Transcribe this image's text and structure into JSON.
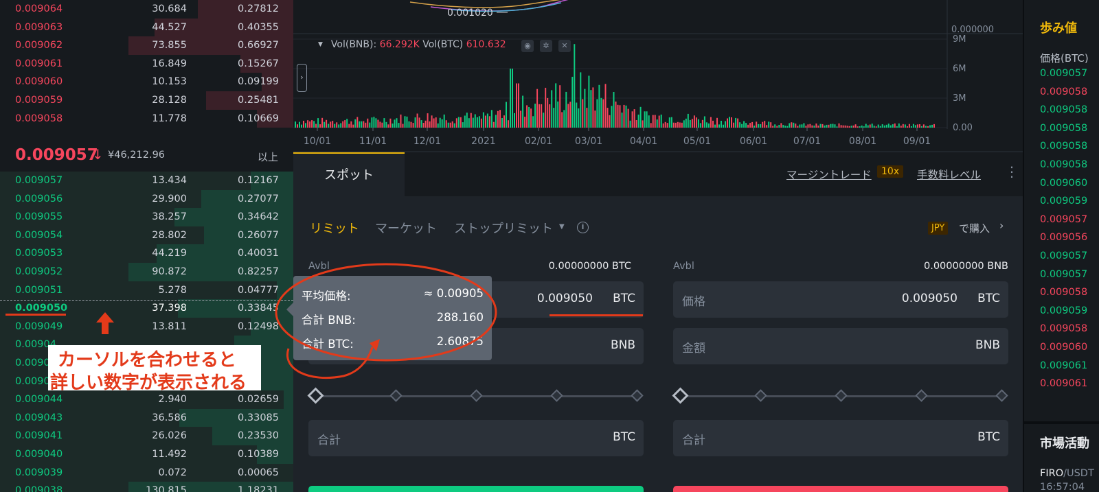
{
  "orderbook": {
    "asks": [
      {
        "price": "0.009064",
        "amount": "30.684",
        "total": "0.27812",
        "depth": 0.58
      },
      {
        "price": "0.009063",
        "amount": "44.527",
        "total": "0.40355",
        "depth": 0.84
      },
      {
        "price": "0.009062",
        "amount": "73.855",
        "total": "0.66927",
        "depth": 1.0
      },
      {
        "price": "0.009061",
        "amount": "16.849",
        "total": "0.15267",
        "depth": 0.32
      },
      {
        "price": "0.009060",
        "amount": "10.153",
        "total": "0.09199",
        "depth": 0.19
      },
      {
        "price": "0.009059",
        "amount": "28.128",
        "total": "0.25481",
        "depth": 0.53
      },
      {
        "price": "0.009058",
        "amount": "11.778",
        "total": "0.10669",
        "depth": 0.22
      }
    ],
    "mid": {
      "price": "0.009057",
      "arrow": "↓",
      "fiat": "¥46,212.96",
      "more": "以上"
    },
    "bids": [
      {
        "price": "0.009057",
        "amount": "13.434",
        "total": "0.12167",
        "depth": 0.26
      },
      {
        "price": "0.009056",
        "amount": "29.900",
        "total": "0.27077",
        "depth": 0.56
      },
      {
        "price": "0.009055",
        "amount": "38.257",
        "total": "0.34642",
        "depth": 0.72
      },
      {
        "price": "0.009054",
        "amount": "28.802",
        "total": "0.26077",
        "depth": 0.54
      },
      {
        "price": "0.009053",
        "amount": "44.219",
        "total": "0.40031",
        "depth": 0.83
      },
      {
        "price": "0.009052",
        "amount": "90.872",
        "total": "0.82257",
        "depth": 1.0
      },
      {
        "price": "0.009051",
        "amount": "5.278",
        "total": "0.04777",
        "depth": 0.1
      },
      {
        "price": "0.009050",
        "amount": "37.398",
        "total": "0.33845",
        "depth": 0.7
      },
      {
        "price": "0.009049",
        "amount": "13.811",
        "total": "0.12498",
        "depth": 0.26
      },
      {
        "price": "0.00904",
        "amount": "",
        "total": "",
        "depth": 0.36
      },
      {
        "price": "0.00904",
        "amount": "",
        "total": "",
        "depth": 0.4
      },
      {
        "price": "0.00904",
        "amount": "",
        "total": "",
        "depth": 0.3
      },
      {
        "price": "0.009044",
        "amount": "2.940",
        "total": "0.02659",
        "depth": 0.06
      },
      {
        "price": "0.009043",
        "amount": "36.586",
        "total": "0.33085",
        "depth": 0.69
      },
      {
        "price": "0.009041",
        "amount": "26.026",
        "total": "0.23530",
        "depth": 0.49
      },
      {
        "price": "0.009040",
        "amount": "11.492",
        "total": "0.10389",
        "depth": 0.22
      },
      {
        "price": "0.009039",
        "amount": "0.072",
        "total": "0.00065",
        "depth": 0.0
      },
      {
        "price": "0.009038",
        "amount": "130.815",
        "total": "1.18231",
        "depth": 1.0
      }
    ],
    "callout": {
      "line1": "カーソルを合わせると",
      "line2": "詳しい数字が表示される"
    }
  },
  "chart": {
    "price_label": "0.001020",
    "axis_zero_price": "0.000000",
    "vol_label_bnb": "Vol(BNB):",
    "vol_value_bnb": "66.292K",
    "vol_label_btc": "Vol(BTC)",
    "vol_value_btc": "610.632",
    "vol_axis": [
      "9M",
      "6M",
      "3M",
      "0.00"
    ],
    "x_ticks": [
      "10/01",
      "11/01",
      "12/01",
      "2021",
      "02/01",
      "03/01",
      "04/01",
      "05/01",
      "06/01",
      "07/01",
      "08/01",
      "09/01"
    ]
  },
  "chart_data": {
    "type": "bar",
    "title": "",
    "xlabel": "",
    "ylabel": "",
    "categories": [
      "10/01",
      "11/01",
      "12/01",
      "2021",
      "02/01",
      "03/01",
      "04/01",
      "05/01",
      "06/01",
      "07/01",
      "08/01",
      "09/01"
    ],
    "series": [
      {
        "name": "Vol(BNB)",
        "values": [
          0.7,
          0.8,
          1.2,
          1.1,
          3.0,
          4.2,
          1.3,
          1.0,
          0.6,
          0.3,
          0.3,
          0.3
        ]
      }
    ],
    "peaks": [
      {
        "x": "03/01",
        "value": 8.5
      },
      {
        "x": "02/01",
        "value": 6.0
      },
      {
        "x": "02/01",
        "value": 4.5
      }
    ],
    "ylim": [
      0,
      9
    ],
    "y_unit": "M",
    "colors": {
      "up": "#0ecb81",
      "down": "#f6465d"
    }
  },
  "spot": {
    "tab": "スポット",
    "margin_link": "マージントレード",
    "margin_badge": "10x",
    "fee_link": "手数料レベル",
    "kebab": "⋮",
    "order_tabs": {
      "limit": "リミット",
      "market": "マーケット",
      "stop": "ストップリミット"
    },
    "stop_caret": "▼",
    "info": "i",
    "jpy_badge": "JPY",
    "jpy_buy": "で購入",
    "chevron": "›",
    "buy": {
      "avbl_label": "Avbl",
      "avbl_value": "0.00000000 BTC",
      "price_value": "0.009050",
      "price_unit": "BTC",
      "amount_unit": "BNB",
      "total_label": "合計",
      "total_unit": "BTC",
      "slider_level": 0
    },
    "sell": {
      "avbl_label": "Avbl",
      "avbl_value": "0.00000000 BNB",
      "price_label": "価格",
      "price_value": "0.009050",
      "price_unit": "BTC",
      "amount_label": "金額",
      "amount_unit": "BNB",
      "total_label": "合計",
      "total_unit": "BTC",
      "slider_level": 0
    }
  },
  "tooltip": {
    "avg_label": "平均価格:",
    "avg_value": "≈ 0.00905",
    "bnb_label": "合計 BNB:",
    "bnb_value": "288.160",
    "btc_label": "合計 BTC:",
    "btc_value": "2.60875"
  },
  "trades": {
    "title": "歩み値",
    "col": "価格(BTC)",
    "rows": [
      {
        "price": "0.009057",
        "side": "buy"
      },
      {
        "price": "0.009058",
        "side": "sell"
      },
      {
        "price": "0.009058",
        "side": "buy"
      },
      {
        "price": "0.009058",
        "side": "buy"
      },
      {
        "price": "0.009058",
        "side": "buy"
      },
      {
        "price": "0.009058",
        "side": "buy"
      },
      {
        "price": "0.009060",
        "side": "buy"
      },
      {
        "price": "0.009059",
        "side": "buy"
      },
      {
        "price": "0.009057",
        "side": "sell"
      },
      {
        "price": "0.009056",
        "side": "sell"
      },
      {
        "price": "0.009057",
        "side": "buy"
      },
      {
        "price": "0.009057",
        "side": "buy"
      },
      {
        "price": "0.009058",
        "side": "sell"
      },
      {
        "price": "0.009059",
        "side": "buy"
      },
      {
        "price": "0.009058",
        "side": "sell"
      },
      {
        "price": "0.009060",
        "side": "sell"
      },
      {
        "price": "0.009061",
        "side": "buy"
      },
      {
        "price": "0.009061",
        "side": "sell"
      }
    ],
    "activity_title": "市場活動",
    "activity_pair_base": "FIRO",
    "activity_pair_quote": "/USDT",
    "activity_time": "16:57:04"
  }
}
